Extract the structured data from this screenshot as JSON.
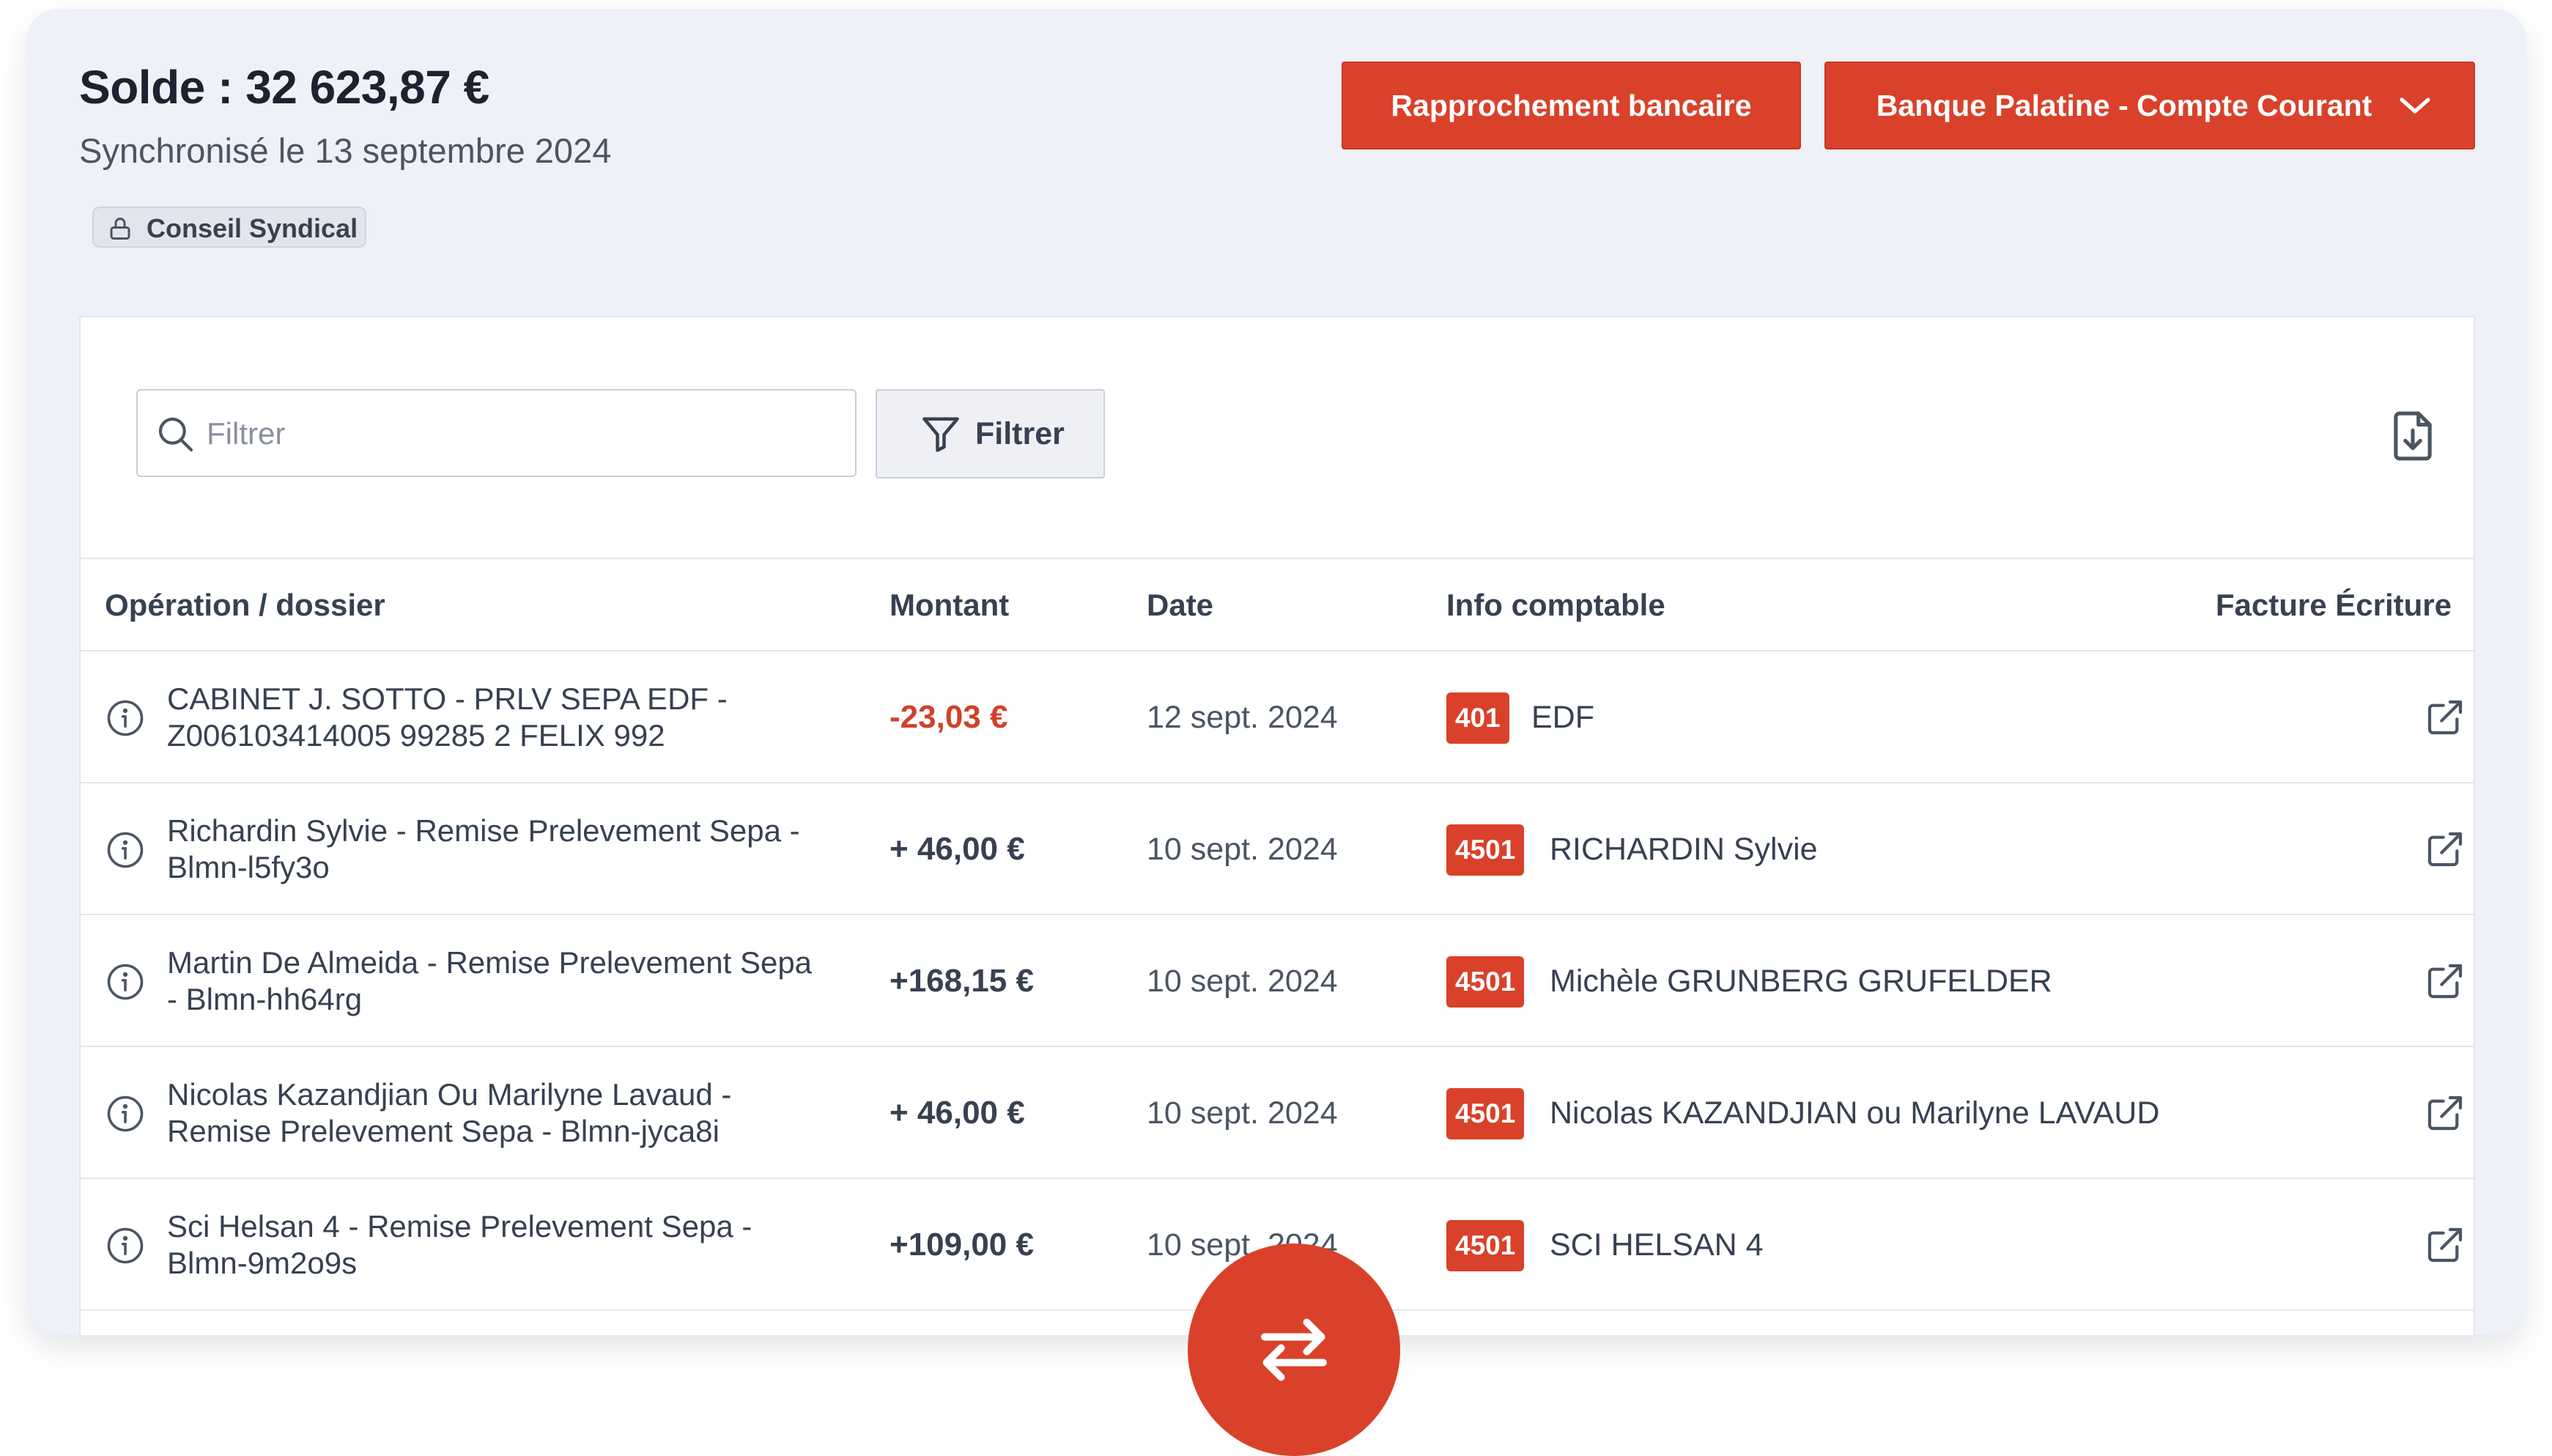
{
  "header": {
    "balance_label": "Solde : 32 623,87 €",
    "sync_text": "Synchronisé le 13 septembre 2024",
    "role_badge": "Conseil Syndical"
  },
  "actions": {
    "reconcile_label": "Rapprochement bancaire",
    "account_selector_label": "Banque Palatine - Compte Courant"
  },
  "toolbar": {
    "search_placeholder": "Filtrer",
    "search_value": "",
    "filter_label": "Filtrer"
  },
  "table": {
    "columns": {
      "operation": "Opération / dossier",
      "amount": "Montant",
      "date": "Date",
      "accounting": "Info comptable",
      "invoice_entry": "Facture Écriture"
    },
    "rows": [
      {
        "label": "CABINET J. SOTTO - PRLV SEPA EDF - Z006103414005 99285 2 FELIX 992",
        "amount": "-23,03 €",
        "amount_negative": true,
        "date": "12 sept. 2024",
        "account_code": "401",
        "account_name": "EDF"
      },
      {
        "label": "Richardin Sylvie - Remise Prelevement Sepa - Blmn-l5fy3o",
        "amount": "+ 46,00 €",
        "amount_negative": false,
        "date": "10 sept. 2024",
        "account_code": "4501",
        "account_name": "RICHARDIN Sylvie"
      },
      {
        "label": "Martin De Almeida - Remise Prelevement Sepa - Blmn-hh64rg",
        "amount": "+168,15 €",
        "amount_negative": false,
        "date": "10 sept. 2024",
        "account_code": "4501",
        "account_name": "Michèle GRUNBERG GRUFELDER"
      },
      {
        "label": "Nicolas Kazandjian Ou Marilyne Lavaud - Remise Prelevement Sepa - Blmn-jyca8i",
        "amount": "+ 46,00 €",
        "amount_negative": false,
        "date": "10 sept. 2024",
        "account_code": "4501",
        "account_name": "Nicolas KAZANDJIAN ou Marilyne LAVAUD"
      },
      {
        "label": "Sci Helsan 4 - Remise Prelevement Sepa - Blmn-9m2o9s",
        "amount": "+109,00 €",
        "amount_negative": false,
        "date": "10 sept. 2024",
        "account_code": "4501",
        "account_name": "SCI HELSAN 4"
      }
    ]
  },
  "icons": {
    "role_badge": "lock-icon",
    "account_selector": "chevron-down-icon",
    "search": "search-icon",
    "filter": "funnel-icon",
    "export": "file-download-icon",
    "row_info": "info-icon",
    "row_open": "external-link-icon",
    "fab": "swap-arrows-icon"
  },
  "colors": {
    "accent": "#d9412a",
    "background": "#eff1f8",
    "negative_amount": "#d2402a"
  }
}
